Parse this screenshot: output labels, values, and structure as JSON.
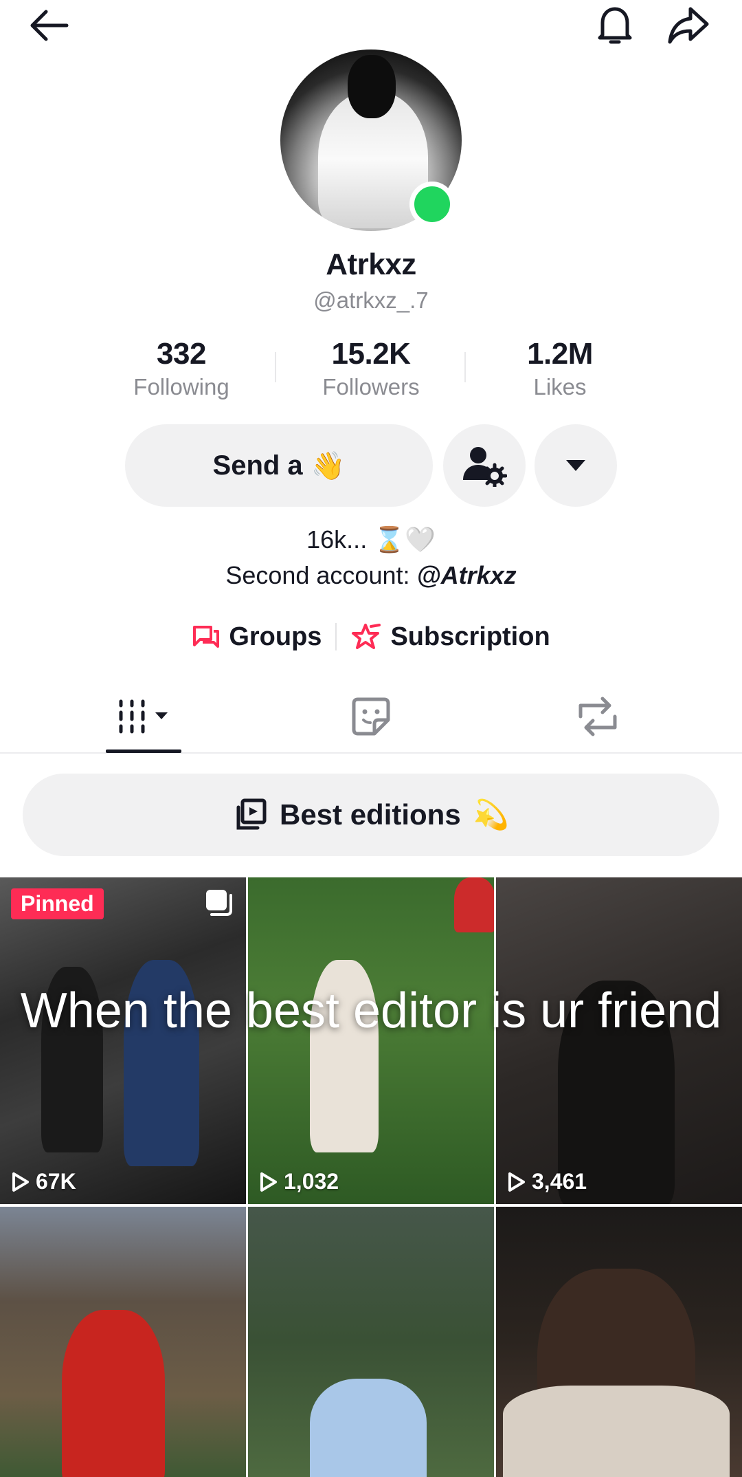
{
  "profile": {
    "display_name": "Atrkxz",
    "username": "@atrkxz_.7",
    "online": true
  },
  "stats": [
    {
      "value": "332",
      "label": "Following"
    },
    {
      "value": "15.2K",
      "label": "Followers"
    },
    {
      "value": "1.2M",
      "label": "Likes"
    }
  ],
  "actions": {
    "send_label": "Send a",
    "send_emoji": "👋"
  },
  "bio": {
    "line1": "16k... ⌛🤍",
    "line2_prefix": "Second account: ",
    "line2_mention": "@Atrkxz"
  },
  "links": {
    "groups": "Groups",
    "subscription": "Subscription"
  },
  "collection": {
    "label": "Best editions",
    "emoji": "💫"
  },
  "videos": [
    {
      "pinned_label": "Pinned",
      "views": "67K"
    },
    {
      "views": "1,032"
    },
    {
      "views": "3,461"
    },
    {},
    {},
    {}
  ],
  "overlay_caption": "When the best editor is ur friend",
  "colors": {
    "accent": "#fe2c55",
    "online": "#20d55e",
    "button_bg": "#f1f1f2",
    "secondary_text": "#8a8b91"
  }
}
